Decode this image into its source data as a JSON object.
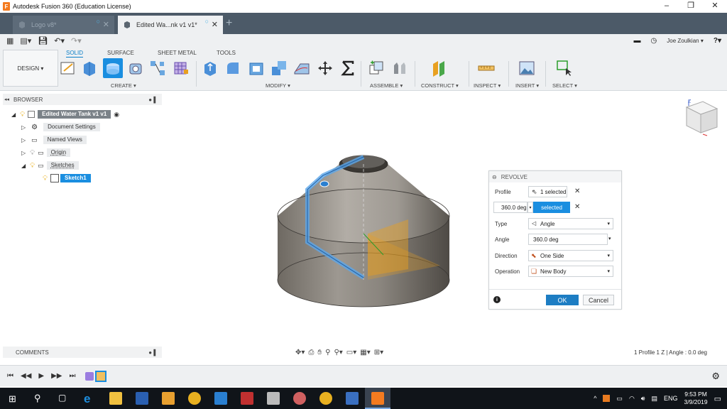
{
  "window": {
    "title": "Autodesk Fusion 360 (Education License)",
    "app_icon_letter": "F",
    "controls": [
      "–",
      "❐",
      "✕"
    ]
  },
  "tabs": [
    {
      "label": "Logo v8*",
      "state": "inactive"
    },
    {
      "label": "Edited Wa...nk v1 v1*",
      "state": "active"
    }
  ],
  "new_tab": "+",
  "user": {
    "name": "Joe Zoulkian ▾",
    "help": "?▾"
  },
  "ribbon": {
    "workspace_label": "DESIGN ▾",
    "tabs": [
      "SOLID",
      "SURFACE",
      "SHEET METAL",
      "TOOLS"
    ],
    "active_tab": "SOLID",
    "groups": [
      "CREATE ▾",
      "MODIFY ▾",
      "ASSEMBLE ▾",
      "CONSTRUCT ▾",
      "INSPECT ▾",
      "INSERT ▾",
      "SELECT ▾"
    ]
  },
  "browser": {
    "title": "BROWSER",
    "items": [
      {
        "label": "Edited Water Tank v1 v1",
        "level": 0,
        "expanded": true
      },
      {
        "label": "Document Settings",
        "level": 1,
        "expanded": false
      },
      {
        "label": "Named Views",
        "level": 1,
        "expanded": false
      },
      {
        "label": "Origin",
        "level": 1,
        "expanded": false
      },
      {
        "label": "Sketches",
        "level": 1,
        "expanded": true
      },
      {
        "label": "Sketch1",
        "level": 2,
        "selected": true
      }
    ]
  },
  "revolve": {
    "title": "REVOLVE",
    "profile_label": "Profile",
    "profile_value": "1 selected",
    "axis_value": "selected",
    "angle_input": "360.0 deg",
    "type_label": "Type",
    "type_value": "Angle",
    "angle_label": "Angle",
    "angle_value": "360.0 deg",
    "direction_label": "Direction",
    "direction_value": "One Side",
    "operation_label": "Operation",
    "operation_value": "New Body",
    "ok": "OK",
    "cancel": "Cancel",
    "info": "i"
  },
  "comments": {
    "title": "COMMENTS"
  },
  "status": "1 Profile 1 Z | Angle : 0.0 deg",
  "clock": {
    "time": "9:53 PM",
    "date": "3/9/2019"
  },
  "tray": {
    "lang": "ENG"
  },
  "colors": {
    "accent": "#0a7ec8",
    "tabbar": "#4c5a68",
    "selection": "#1a8ee0",
    "taskbar": "#101419"
  }
}
